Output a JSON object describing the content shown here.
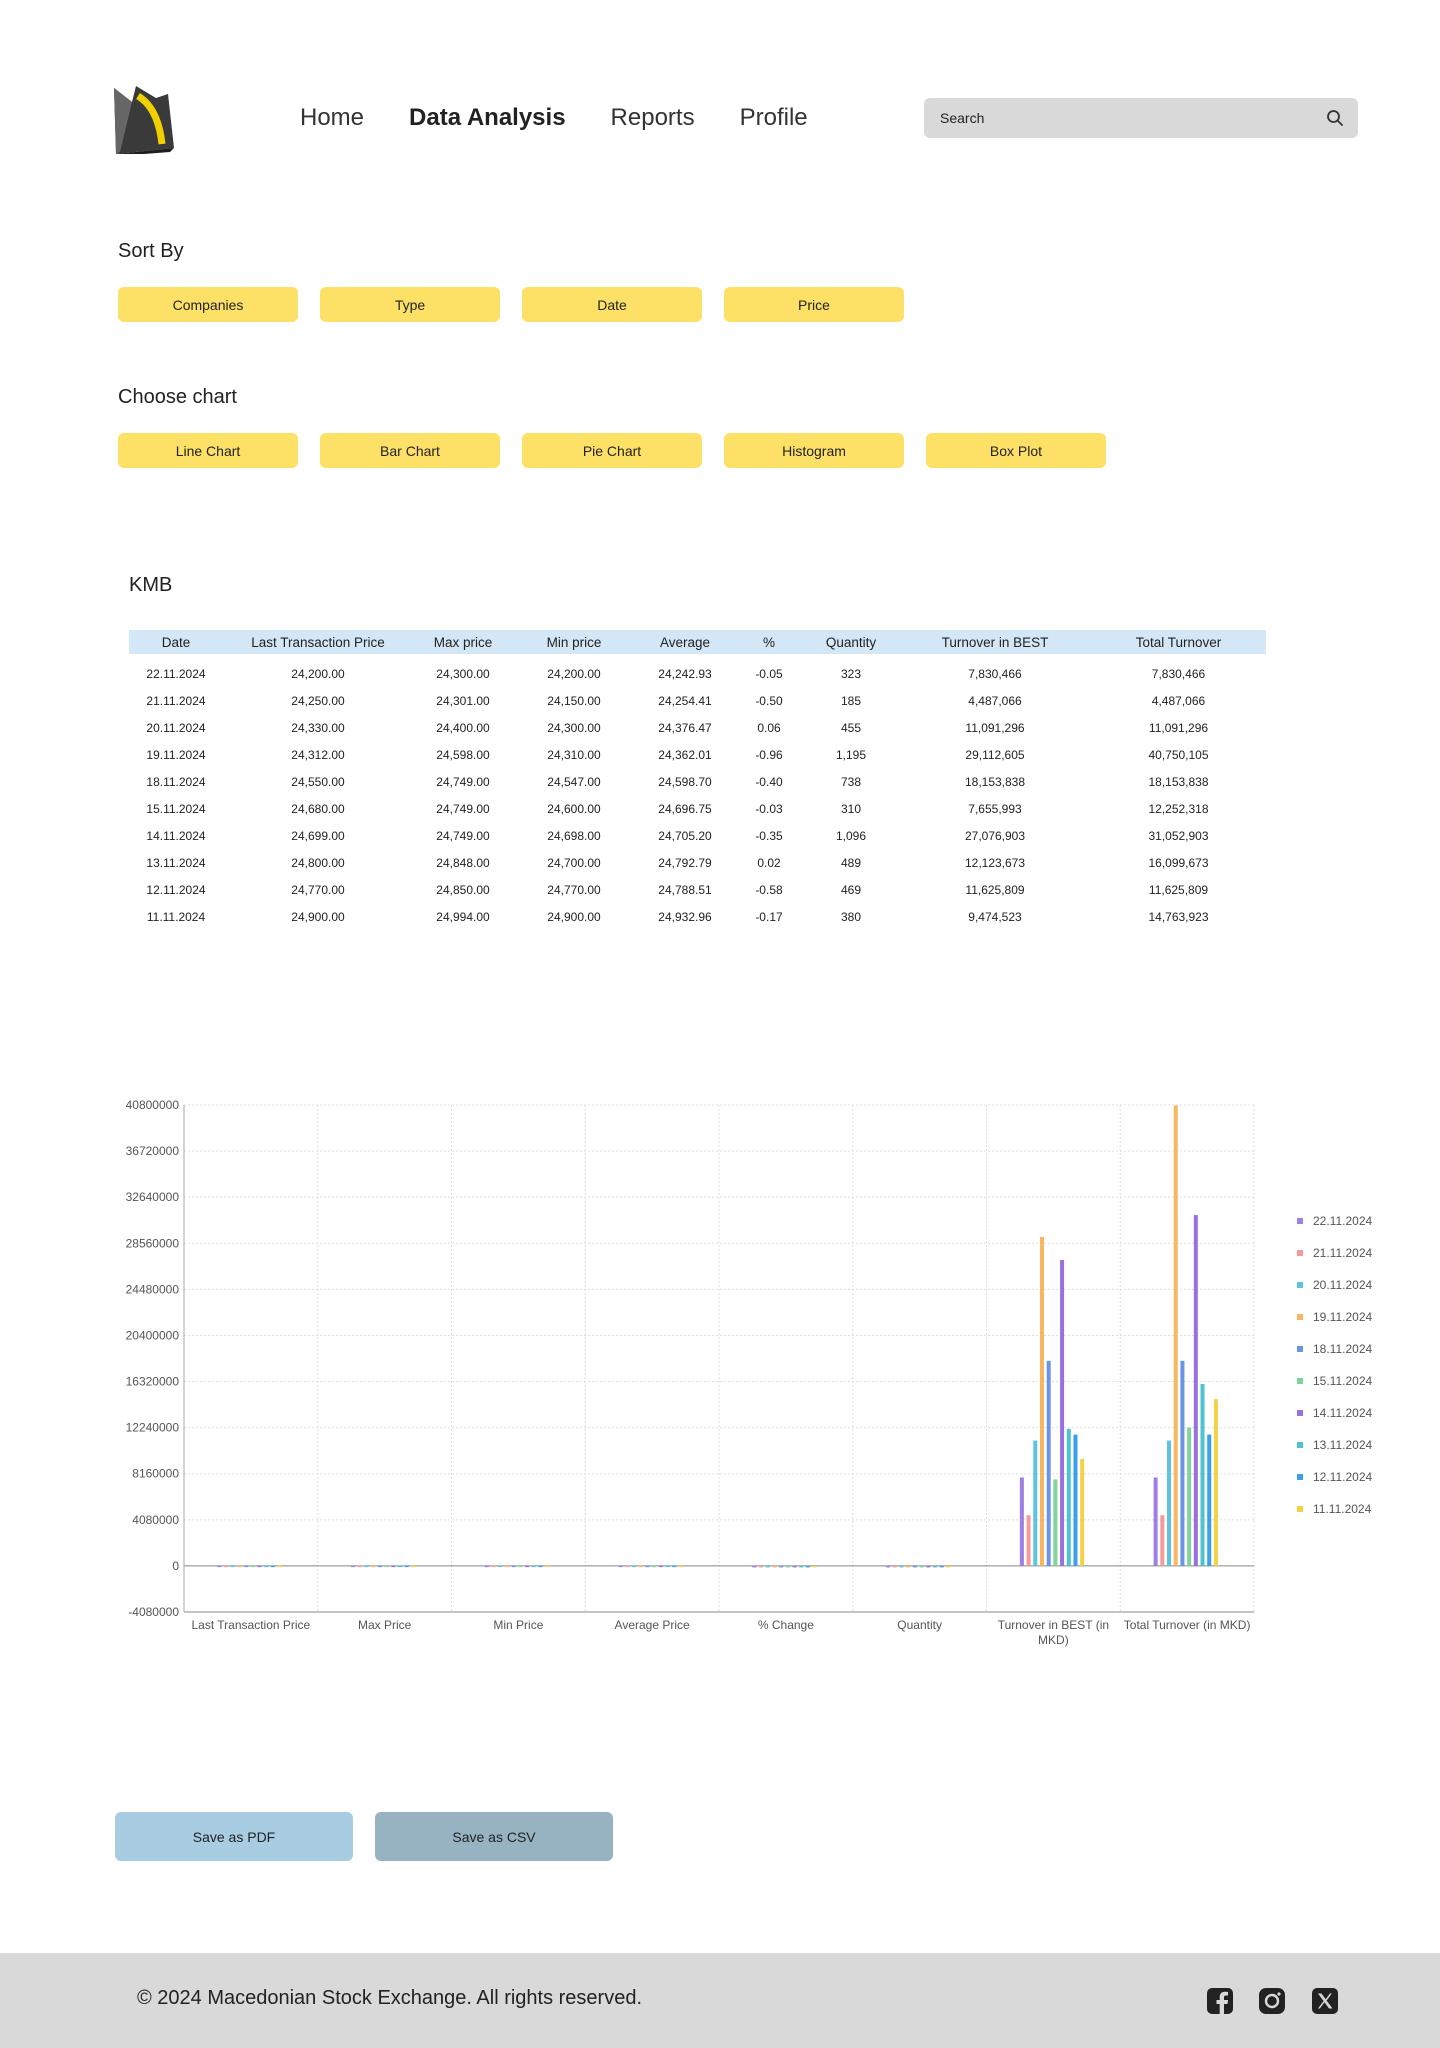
{
  "nav": {
    "items": [
      {
        "label": "Home",
        "active": false
      },
      {
        "label": "Data Analysis",
        "active": true
      },
      {
        "label": "Reports",
        "active": false
      },
      {
        "label": "Profile",
        "active": false
      }
    ]
  },
  "search": {
    "placeholder": "Search",
    "icon": "search-icon"
  },
  "sort": {
    "title": "Sort By",
    "options": [
      "Companies",
      "Type",
      "Date",
      "Price"
    ]
  },
  "chart_choice": {
    "title": "Choose chart",
    "options": [
      "Line Chart",
      "Bar Chart",
      "Pie Chart",
      "Histogram",
      "Box Plot"
    ]
  },
  "table": {
    "title": "KMB",
    "headers": [
      "Date",
      "Last Transaction Price",
      "Max price",
      "Min price",
      "Average",
      "%",
      "Quantity",
      "Turnover in BEST",
      "Total Turnover"
    ],
    "rows": [
      [
        "22.11.2024",
        "24,200.00",
        "24,300.00",
        "24,200.00",
        "24,242.93",
        "-0.05",
        "323",
        "7,830,466",
        "7,830,466"
      ],
      [
        "21.11.2024",
        "24,250.00",
        "24,301.00",
        "24,150.00",
        "24,254.41",
        "-0.50",
        "185",
        "4,487,066",
        "4,487,066"
      ],
      [
        "20.11.2024",
        "24,330.00",
        "24,400.00",
        "24,300.00",
        "24,376.47",
        "0.06",
        "455",
        "11,091,296",
        "11,091,296"
      ],
      [
        "19.11.2024",
        "24,312.00",
        "24,598.00",
        "24,310.00",
        "24,362.01",
        "-0.96",
        "1,195",
        "29,112,605",
        "40,750,105"
      ],
      [
        "18.11.2024",
        "24,550.00",
        "24,749.00",
        "24,547.00",
        "24,598.70",
        "-0.40",
        "738",
        "18,153,838",
        "18,153,838"
      ],
      [
        "15.11.2024",
        "24,680.00",
        "24,749.00",
        "24,600.00",
        "24,696.75",
        "-0.03",
        "310",
        "7,655,993",
        "12,252,318"
      ],
      [
        "14.11.2024",
        "24,699.00",
        "24,749.00",
        "24,698.00",
        "24,705.20",
        "-0.35",
        "1,096",
        "27,076,903",
        "31,052,903"
      ],
      [
        "13.11.2024",
        "24,800.00",
        "24,848.00",
        "24,700.00",
        "24,792.79",
        "0.02",
        "489",
        "12,123,673",
        "16,099,673"
      ],
      [
        "12.11.2024",
        "24,770.00",
        "24,850.00",
        "24,770.00",
        "24,788.51",
        "-0.58",
        "469",
        "11,625,809",
        "11,625,809"
      ],
      [
        "11.11.2024",
        "24,900.00",
        "24,994.00",
        "24,900.00",
        "24,932.96",
        "-0.17",
        "380",
        "9,474,523",
        "14,763,923"
      ]
    ]
  },
  "chart_data": {
    "type": "bar",
    "categories": [
      "Last Transaction Price",
      "Max Price",
      "Min Price",
      "Average Price",
      "% Change",
      "Quantity",
      "Turnover in BEST (in MKD)",
      "Total Turnover (in MKD)"
    ],
    "ylim": [
      -4080000,
      40800000
    ],
    "yticks": [
      40800000,
      36720000,
      32640000,
      28560000,
      24480000,
      20400000,
      16320000,
      12240000,
      8160000,
      4080000,
      0,
      -4080000
    ],
    "grid": true,
    "legend_position": "right",
    "series": [
      {
        "name": "22.11.2024",
        "color": "#9d7fe6",
        "values": [
          24200,
          24300,
          24200,
          24242.93,
          -0.05,
          323,
          7830466,
          7830466
        ]
      },
      {
        "name": "21.11.2024",
        "color": "#f59a9a",
        "values": [
          24250,
          24301,
          24150,
          24254.41,
          -0.5,
          185,
          4487066,
          4487066
        ]
      },
      {
        "name": "20.11.2024",
        "color": "#5cc4e0",
        "values": [
          24330,
          24400,
          24300,
          24376.47,
          0.06,
          455,
          11091296,
          11091296
        ]
      },
      {
        "name": "19.11.2024",
        "color": "#f8b562",
        "values": [
          24312,
          24598,
          24310,
          24362.01,
          -0.96,
          1195,
          29112605,
          40750105
        ]
      },
      {
        "name": "18.11.2024",
        "color": "#6b93e6",
        "values": [
          24550,
          24749,
          24547,
          24598.7,
          -0.4,
          738,
          18153838,
          18153838
        ]
      },
      {
        "name": "15.11.2024",
        "color": "#7fd49a",
        "values": [
          24680,
          24749,
          24600,
          24696.75,
          -0.03,
          310,
          7655993,
          12252318
        ]
      },
      {
        "name": "14.11.2024",
        "color": "#9a6fe0",
        "values": [
          24699,
          24749,
          24698,
          24705.2,
          -0.35,
          1096,
          27076903,
          31052903
        ]
      },
      {
        "name": "13.11.2024",
        "color": "#4dc3cf",
        "values": [
          24800,
          24848,
          24700,
          24792.79,
          0.02,
          489,
          12123673,
          16099673
        ]
      },
      {
        "name": "12.11.2024",
        "color": "#3b9ff0",
        "values": [
          24770,
          24850,
          24770,
          24788.51,
          -0.58,
          469,
          11625809,
          11625809
        ]
      },
      {
        "name": "11.11.2024",
        "color": "#f5d146",
        "values": [
          24900,
          24994,
          24900,
          24932.96,
          -0.17,
          380,
          9474523,
          14763923
        ]
      }
    ]
  },
  "actions": {
    "pdf_label": "Save as PDF",
    "csv_label": "Save as CSV"
  },
  "footer": {
    "copyright": "© 2024 Macedonian Stock Exchange. All rights reserved.",
    "social": [
      "facebook-icon",
      "instagram-icon",
      "x-icon"
    ]
  },
  "colors": {
    "accent_yellow": "#fde066",
    "table_header": "#d3e7f7",
    "pdf_button": "#a8cde2",
    "csv_button": "#97b3c1",
    "footer_bg": "#d9d9d9"
  }
}
